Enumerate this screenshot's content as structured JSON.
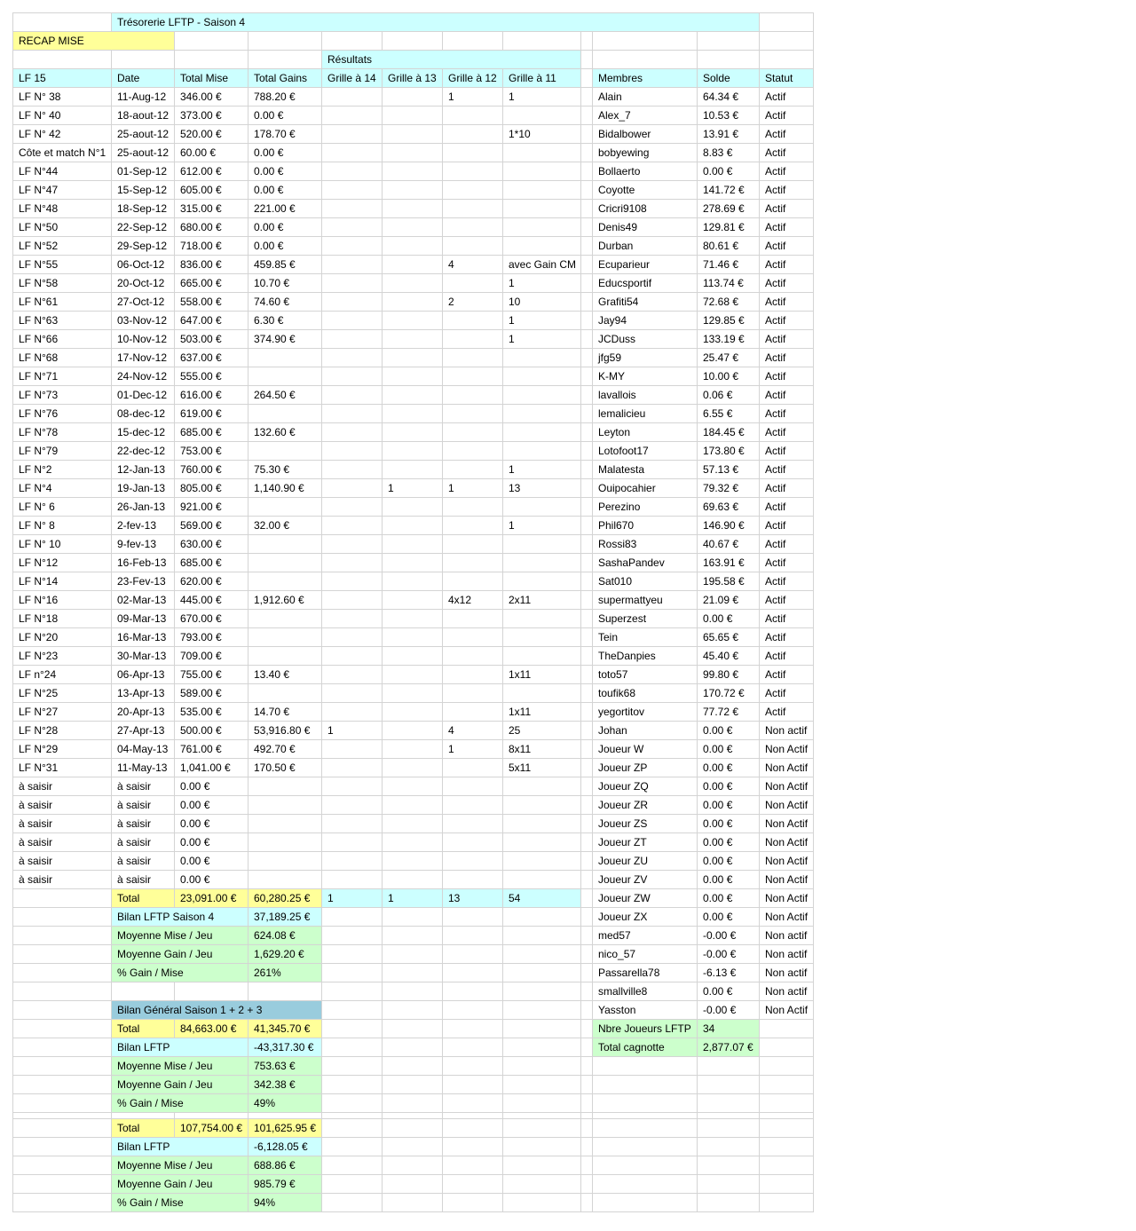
{
  "title": "Trésorerie LFTP - Saison 4",
  "recap_label": "RECAP MISE",
  "resultats_label": "Résultats",
  "headers": [
    "LF 15",
    "Date",
    "Total Mise",
    "Total Gains",
    "Grille à 14",
    "Grille à 13",
    "Grille à 12",
    "Grille à 11"
  ],
  "member_headers": [
    "Membres",
    "Solde",
    "Statut"
  ],
  "games": [
    [
      "LF N° 38",
      "11-Aug-12",
      "346.00 €",
      "788.20 €",
      "",
      "",
      "1",
      "1"
    ],
    [
      "LF N° 40",
      "18-aout-12",
      "373.00 €",
      "0.00 €",
      "",
      "",
      "",
      ""
    ],
    [
      "LF N° 42",
      "25-aout-12",
      "520.00 €",
      "178.70 €",
      "",
      "",
      "",
      "1*10"
    ],
    [
      "Côte et match N°1",
      "25-aout-12",
      "60.00 €",
      "0.00 €",
      "",
      "",
      "",
      ""
    ],
    [
      "LF N°44",
      "01-Sep-12",
      "612.00 €",
      "0.00 €",
      "",
      "",
      "",
      ""
    ],
    [
      "LF N°47",
      "15-Sep-12",
      "605.00 €",
      "0.00 €",
      "",
      "",
      "",
      ""
    ],
    [
      "LF N°48",
      "18-Sep-12",
      "315.00 €",
      "221.00 €",
      "",
      "",
      "",
      ""
    ],
    [
      "LF N°50",
      "22-Sep-12",
      "680.00 €",
      "0.00 €",
      "",
      "",
      "",
      ""
    ],
    [
      "LF N°52",
      "29-Sep-12",
      "718.00 €",
      "0.00 €",
      "",
      "",
      "",
      ""
    ],
    [
      "LF N°55",
      "06-Oct-12",
      "836.00 €",
      "459.85 €",
      "",
      "",
      "4",
      "avec Gain CM"
    ],
    [
      "LF N°58",
      "20-Oct-12",
      "665.00 €",
      "10.70 €",
      "",
      "",
      "",
      "1"
    ],
    [
      "LF N°61",
      "27-Oct-12",
      "558.00 €",
      "74.60 €",
      "",
      "",
      "2",
      "10"
    ],
    [
      "LF N°63",
      "03-Nov-12",
      "647.00 €",
      "6.30 €",
      "",
      "",
      "",
      "1"
    ],
    [
      "LF N°66",
      "10-Nov-12",
      "503.00 €",
      "374.90 €",
      "",
      "",
      "",
      "1"
    ],
    [
      "LF N°68",
      "17-Nov-12",
      "637.00 €",
      "",
      "",
      "",
      "",
      ""
    ],
    [
      "LF N°71",
      "24-Nov-12",
      "555.00 €",
      "",
      "",
      "",
      "",
      ""
    ],
    [
      "LF N°73",
      "01-Dec-12",
      "616.00 €",
      "264.50 €",
      "",
      "",
      "",
      ""
    ],
    [
      "LF N°76",
      "08-dec-12",
      "619.00 €",
      "",
      "",
      "",
      "",
      ""
    ],
    [
      "LF N°78",
      "15-dec-12",
      "685.00 €",
      "132.60 €",
      "",
      "",
      "",
      ""
    ],
    [
      "LF N°79",
      "22-dec-12",
      "753.00 €",
      "",
      "",
      "",
      "",
      ""
    ],
    [
      "LF N°2",
      "12-Jan-13",
      "760.00 €",
      "75.30 €",
      "",
      "",
      "",
      "1"
    ],
    [
      "LF N°4",
      "19-Jan-13",
      "805.00 €",
      "1,140.90 €",
      "",
      "1",
      "1",
      "13"
    ],
    [
      "LF N° 6",
      "26-Jan-13",
      "921.00 €",
      "",
      "",
      "",
      "",
      ""
    ],
    [
      "LF N° 8",
      "2-fev-13",
      "569.00 €",
      "32.00 €",
      "",
      "",
      "",
      "1"
    ],
    [
      "LF N° 10",
      "9-fev-13",
      "630.00 €",
      "",
      "",
      "",
      "",
      ""
    ],
    [
      "LF N°12",
      "16-Feb-13",
      "685.00 €",
      "",
      "",
      "",
      "",
      ""
    ],
    [
      "LF N°14",
      "23-Fev-13",
      "620.00 €",
      "",
      "",
      "",
      "",
      ""
    ],
    [
      "LF N°16",
      "02-Mar-13",
      "445.00 €",
      "1,912.60 €",
      "",
      "",
      "4x12",
      "2x11"
    ],
    [
      "LF N°18",
      "09-Mar-13",
      "670.00 €",
      "",
      "",
      "",
      "",
      ""
    ],
    [
      "LF N°20",
      "16-Mar-13",
      "793.00 €",
      "",
      "",
      "",
      "",
      ""
    ],
    [
      "LF N°23",
      "30-Mar-13",
      "709.00 €",
      "",
      "",
      "",
      "",
      ""
    ],
    [
      "LF n°24",
      "06-Apr-13",
      "755.00 €",
      "13.40 €",
      "",
      "",
      "",
      "1x11"
    ],
    [
      "LF N°25",
      "13-Apr-13",
      "589.00 €",
      "",
      "",
      "",
      "",
      ""
    ],
    [
      "LF N°27",
      "20-Apr-13",
      "535.00 €",
      "14.70 €",
      "",
      "",
      "",
      "1x11"
    ],
    [
      "LF N°28",
      "27-Apr-13",
      "500.00 €",
      "53,916.80 €",
      "1",
      "",
      "4",
      "25"
    ],
    [
      "LF N°29",
      "04-May-13",
      "761.00 €",
      "492.70 €",
      "",
      "",
      "1",
      "8x11"
    ],
    [
      "LF N°31",
      "11-May-13",
      "1,041.00 €",
      "170.50 €",
      "",
      "",
      "",
      "5x11"
    ],
    [
      "à saisir",
      "à saisir",
      "0.00 €",
      "",
      "",
      "",
      "",
      ""
    ],
    [
      "à saisir",
      "à saisir",
      "0.00 €",
      "",
      "",
      "",
      "",
      ""
    ],
    [
      "à saisir",
      "à saisir",
      "0.00 €",
      "",
      "",
      "",
      "",
      ""
    ],
    [
      "à saisir",
      "à saisir",
      "0.00 €",
      "",
      "",
      "",
      "",
      ""
    ],
    [
      "à saisir",
      "à saisir",
      "0.00 €",
      "",
      "",
      "",
      "",
      ""
    ],
    [
      "à saisir",
      "à saisir",
      "0.00 €",
      "",
      "",
      "",
      "",
      ""
    ]
  ],
  "members": [
    [
      "Alain",
      "64.34 €",
      "Actif"
    ],
    [
      "Alex_7",
      "10.53 €",
      "Actif"
    ],
    [
      "Bidalbower",
      "13.91 €",
      "Actif"
    ],
    [
      "bobyewing",
      "8.83 €",
      "Actif"
    ],
    [
      "Bollaerto",
      "0.00 €",
      "Actif"
    ],
    [
      "Coyotte",
      "141.72 €",
      "Actif"
    ],
    [
      "Cricri9108",
      "278.69 €",
      "Actif"
    ],
    [
      "Denis49",
      "129.81 €",
      "Actif"
    ],
    [
      "Durban",
      "80.61 €",
      "Actif"
    ],
    [
      "Ecuparieur",
      "71.46 €",
      "Actif"
    ],
    [
      "Educsportif",
      "113.74 €",
      "Actif"
    ],
    [
      "Grafiti54",
      "72.68 €",
      "Actif"
    ],
    [
      "Jay94",
      "129.85 €",
      "Actif"
    ],
    [
      "JCDuss",
      "133.19 €",
      "Actif"
    ],
    [
      "jfg59",
      "25.47 €",
      "Actif"
    ],
    [
      "K-MY",
      "10.00 €",
      "Actif"
    ],
    [
      "lavallois",
      "0.06 €",
      "Actif"
    ],
    [
      "lemalicieu",
      "6.55 €",
      "Actif"
    ],
    [
      "Leyton",
      "184.45 €",
      "Actif"
    ],
    [
      "Lotofoot17",
      "173.80 €",
      "Actif"
    ],
    [
      "Malatesta",
      "57.13 €",
      "Actif"
    ],
    [
      "Ouipocahier",
      "79.32 €",
      "Actif"
    ],
    [
      "Perezino",
      "69.63 €",
      "Actif"
    ],
    [
      "Phil670",
      "146.90 €",
      "Actif"
    ],
    [
      "Rossi83",
      "40.67 €",
      "Actif"
    ],
    [
      "SashaPandev",
      "163.91 €",
      "Actif"
    ],
    [
      "Sat010",
      "195.58 €",
      "Actif"
    ],
    [
      "supermattyeu",
      "21.09 €",
      "Actif"
    ],
    [
      "Superzest",
      "0.00 €",
      "Actif"
    ],
    [
      "Tein",
      "65.65 €",
      "Actif"
    ],
    [
      "TheDanpies",
      "45.40 €",
      "Actif"
    ],
    [
      "toto57",
      "99.80 €",
      "Actif"
    ],
    [
      "toufik68",
      "170.72 €",
      "Actif"
    ],
    [
      "yegortitov",
      "77.72 €",
      "Actif"
    ],
    [
      "Johan",
      "0.00 €",
      "Non actif"
    ],
    [
      "Joueur W",
      "0.00 €",
      "Non Actif"
    ],
    [
      "Joueur ZP",
      "0.00 €",
      "Non Actif"
    ],
    [
      "Joueur ZQ",
      "0.00 €",
      "Non Actif"
    ],
    [
      "Joueur ZR",
      "0.00 €",
      "Non Actif"
    ],
    [
      "Joueur ZS",
      "0.00 €",
      "Non Actif"
    ],
    [
      "Joueur ZT",
      "0.00 €",
      "Non Actif"
    ],
    [
      "Joueur ZU",
      "0.00 €",
      "Non Actif"
    ],
    [
      "Joueur ZV",
      "0.00 €",
      "Non Actif"
    ],
    [
      "Joueur ZW",
      "0.00 €",
      "Non Actif"
    ],
    [
      "Joueur ZX",
      "0.00 €",
      "Non Actif"
    ],
    [
      "med57",
      "-0.00 €",
      "Non actif"
    ],
    [
      "nico_57",
      "-0.00 €",
      "Non actif"
    ],
    [
      "Passarella78",
      "-6.13 €",
      "Non actif"
    ],
    [
      "smallville8",
      "0.00 €",
      "Non actif"
    ],
    [
      "Yasston",
      "-0.00 €",
      "Non Actif"
    ]
  ],
  "totals_s4": {
    "label": "Total",
    "mise": "23,091.00 €",
    "gains": "60,280.25 €",
    "g14": "1",
    "g13": "1",
    "g12": "13",
    "g11": "54"
  },
  "bilan_s4": [
    {
      "label": "Bilan LFTP Saison 4",
      "value": "37,189.25 €"
    },
    {
      "label": "Moyenne Mise / Jeu",
      "value": "624.08 €"
    },
    {
      "label": "Moyenne Gain / Jeu",
      "value": "1,629.20 €"
    },
    {
      "label": "% Gain / Mise",
      "value": "261%"
    }
  ],
  "bilan_general_title": "Bilan Général Saison 1 + 2 + 3",
  "totals_s123": {
    "label": "Total",
    "mise": "84,663.00 €",
    "gains": "41,345.70 €"
  },
  "bilan_s123": [
    {
      "label": "Bilan LFTP",
      "value": "-43,317.30 €"
    },
    {
      "label": "Moyenne Mise / Jeu",
      "value": "753.63 €"
    },
    {
      "label": "Moyenne Gain / Jeu",
      "value": "342.38 €"
    },
    {
      "label": "% Gain / Mise",
      "value": "49%"
    }
  ],
  "totals_all": {
    "label": "Total",
    "mise": "107,754.00 €",
    "gains": "101,625.95 €"
  },
  "bilan_all": [
    {
      "label": "Bilan LFTP",
      "value": "-6,128.05 €"
    },
    {
      "label": "Moyenne Mise / Jeu",
      "value": "688.86 €"
    },
    {
      "label": "Moyenne Gain / Jeu",
      "value": "985.79 €"
    },
    {
      "label": "% Gain / Mise",
      "value": "94%"
    }
  ],
  "stats": [
    {
      "label": "Nbre Joueurs LFTP",
      "value": "34"
    },
    {
      "label": "Total cagnotte",
      "value": "2,877.07 €"
    }
  ],
  "colors": {
    "cyan": "#ccffff",
    "yellow": "#ffff99",
    "green": "#ccffcc",
    "blue": "#99ccdd",
    "grid": "#d4d4d4"
  }
}
